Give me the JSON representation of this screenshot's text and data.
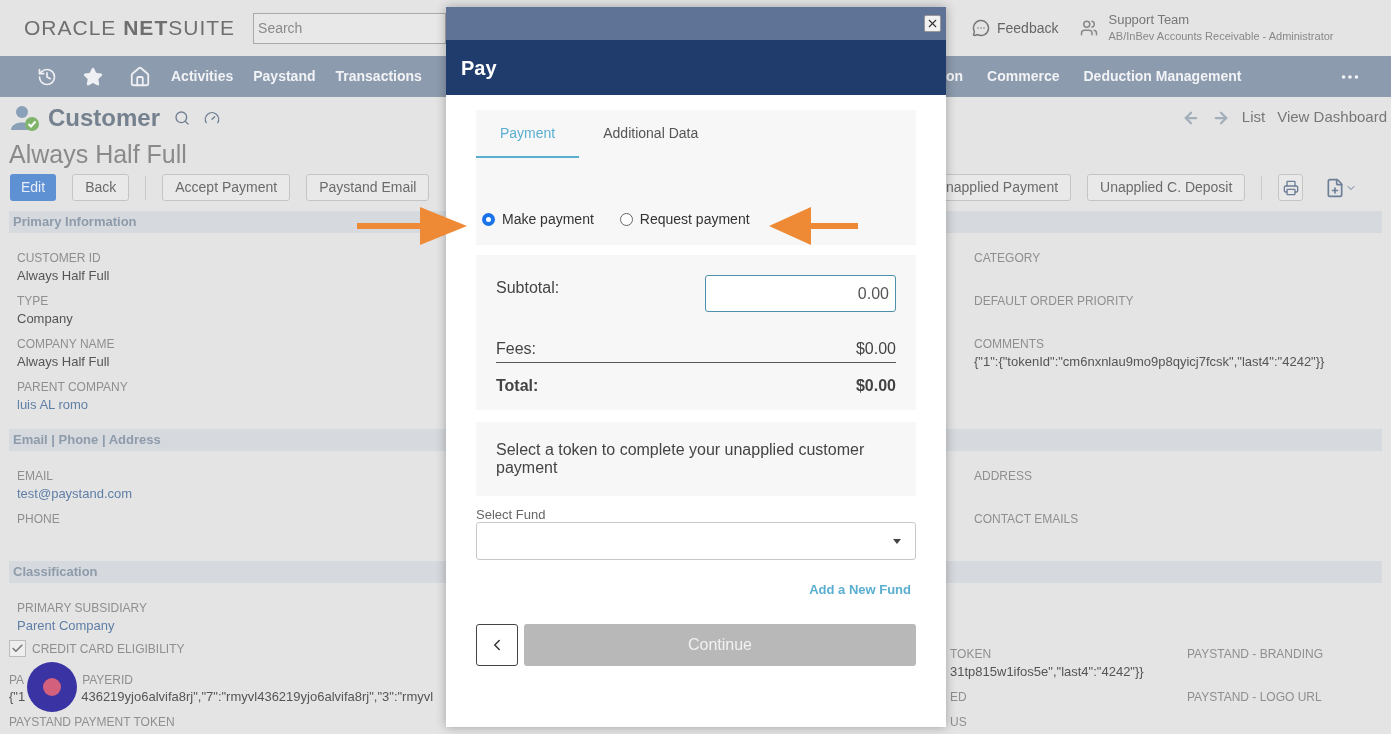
{
  "header": {
    "logo": "ORACLE **NET**SUITE",
    "search": {
      "placeholder": "Search"
    },
    "feedback": "Feedback",
    "account": {
      "name": "Support Team",
      "role": "AB/InBev Accounts Receivable - Administrator"
    }
  },
  "nav": {
    "left": [
      "Activities",
      "Paystand",
      "Transactions"
    ],
    "right": [
      "on",
      "Commerce",
      "Deduction Management"
    ]
  },
  "record": {
    "type": "Customer",
    "name": "Always Half Full",
    "pager": [
      "List",
      "View Dashboard"
    ]
  },
  "buttons_left": [
    {
      "label": "Edit",
      "primary": true
    },
    {
      "label": "Back",
      "primary": false
    },
    {
      "label": "Accept Payment",
      "primary": false
    },
    {
      "label": "Paystand Email",
      "primary": false
    }
  ],
  "buttons_right": [
    {
      "label": "napplied Payment",
      "cut": true
    },
    {
      "label": "Unapplied C. Deposit",
      "cut": false
    }
  ],
  "sections": [
    {
      "title": "Primary Information",
      "left": [
        {
          "label": "CUSTOMER ID",
          "value": "Always Half Full",
          "link": false
        },
        {
          "label": "TYPE",
          "value": "Company",
          "link": false
        },
        {
          "label": "COMPANY NAME",
          "value": "Always Half Full",
          "link": false
        },
        {
          "label": "PARENT COMPANY",
          "value": "luis AL romo",
          "link": true
        }
      ],
      "right": [
        {
          "label": "CATEGORY"
        },
        {
          "label": "DEFAULT ORDER PRIORITY"
        },
        {
          "label": "COMMENTS",
          "value": "{\"1\":{\"tokenId\":\"cm6nxnlau9mo9p8qyicj7fcsk\",\"last4\":\"4242\"}}",
          "link": false
        }
      ]
    },
    {
      "title": "Email | Phone | Address",
      "left": [
        {
          "label": "EMAIL",
          "value": "test@paystand.com",
          "link": true
        },
        {
          "label": "PHONE"
        }
      ],
      "right": [
        {
          "label": "ADDRESS"
        },
        {
          "label": "CONTACT EMAILS"
        }
      ]
    },
    {
      "title": "Classification",
      "left": [
        {
          "label": "PRIMARY SUBSIDIARY",
          "value": "Parent Company",
          "link": true
        }
      ]
    }
  ],
  "bottom": {
    "left": [
      {
        "kind": "checkbox",
        "label": "CREDIT CARD ELIGIBILITY",
        "checked": true
      },
      {
        "kind": "split",
        "label_parts": [
          "PA",
          "PAYERID"
        ],
        "value_parts": [
          "{\"1",
          "436219yjo6alvifa8rj\",\"7\":\"rmyvl436219yjo6alvifa8rj\",\"3\":\"rmyvl"
        ]
      },
      {
        "kind": "field",
        "label": "PAYSTAND PAYMENT TOKEN"
      }
    ],
    "middle": [
      {
        "label": "TOKEN",
        "value": "31tp815w1ifos5e\",\"last4\":\"4242\"}}"
      },
      {
        "label": "ED"
      },
      {
        "label": "US"
      }
    ],
    "right": [
      {
        "label": "PAYSTAND - BRANDING"
      },
      {
        "label": "PAYSTAND - LOGO URL"
      }
    ]
  },
  "modal": {
    "title": "Pay",
    "tabs": [
      {
        "label": "Payment",
        "selected": true
      },
      {
        "label": "Additional Data",
        "selected": false
      }
    ],
    "options": [
      {
        "label": "Make payment",
        "selected": true
      },
      {
        "label": "Request payment",
        "selected": false
      }
    ],
    "subtotal": {
      "label": "Subtotal:",
      "value": "0.00"
    },
    "fees": {
      "label": "Fees:",
      "value": "$0.00"
    },
    "total": {
      "label": "Total:",
      "value": "$0.00"
    },
    "message": "Select a token to complete your unapplied customer payment",
    "fund": {
      "label": "Select Fund"
    },
    "add_fund": "Add a New Fund",
    "continue": {
      "label": "Continue",
      "disabled": true
    }
  }
}
